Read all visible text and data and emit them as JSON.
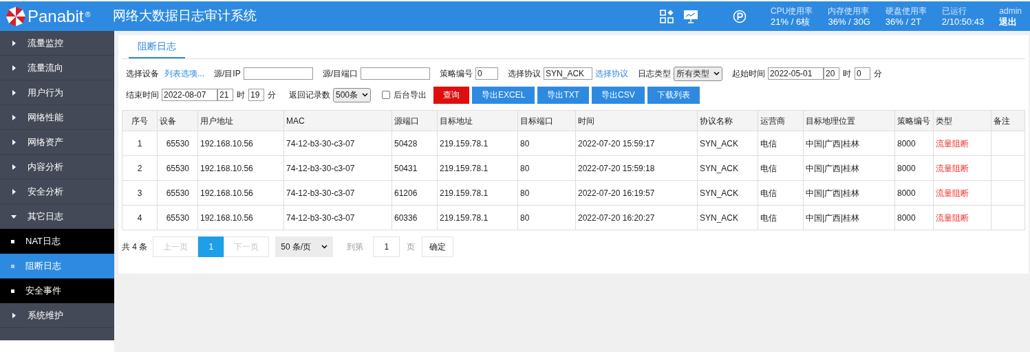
{
  "header": {
    "logo": "Panabit",
    "logo_mark": "®",
    "title": "网络大数据日志审计系统",
    "stats": [
      {
        "label": "CPU使用率",
        "value": "21% / 6核"
      },
      {
        "label": "内存使用率",
        "value": "36% / 30G"
      },
      {
        "label": "硬盘使用率",
        "value": "36% / 2T"
      },
      {
        "label": "已运行",
        "value": "2/10:50:43"
      }
    ],
    "user": "admin",
    "logout": "退出"
  },
  "sidebar": {
    "items": [
      {
        "label": "流量监控",
        "expanded": false
      },
      {
        "label": "流量流向",
        "expanded": false
      },
      {
        "label": "用户行为",
        "expanded": false
      },
      {
        "label": "网络性能",
        "expanded": false
      },
      {
        "label": "网络资产",
        "expanded": false
      },
      {
        "label": "内容分析",
        "expanded": false
      },
      {
        "label": "安全分析",
        "expanded": false
      },
      {
        "label": "其它日志",
        "expanded": true,
        "children": [
          {
            "label": "NAT日志",
            "selected": false
          },
          {
            "label": "阻断日志",
            "selected": true
          },
          {
            "label": "安全事件",
            "selected": false
          }
        ]
      },
      {
        "label": "系统维护",
        "expanded": false
      }
    ]
  },
  "tabs": [
    {
      "label": "阻断日志",
      "selected": true
    }
  ],
  "filters": [
    [
      {
        "kind": "label",
        "text": "选择设备"
      },
      {
        "kind": "link",
        "text": "列表选项..."
      },
      {
        "kind": "label",
        "text": "源/目IP"
      },
      {
        "kind": "input"
      },
      {
        "kind": "label",
        "text": "源/目端口"
      },
      {
        "kind": "input"
      },
      {
        "kind": "label",
        "text": "策略编号"
      },
      {
        "kind": "input",
        "value": "0"
      },
      {
        "kind": "label",
        "text": "选择协议"
      },
      {
        "kind": "input",
        "value": "SYN_ACK"
      },
      {
        "kind": "link",
        "text": "选择协议"
      },
      {
        "kind": "label",
        "text": "日志类型"
      },
      {
        "kind": "select",
        "value": "所有类型"
      },
      {
        "kind": "label",
        "text": "起始时间"
      },
      {
        "kind": "input",
        "value": "2022-05-01"
      },
      {
        "kind": "input",
        "value": "20"
      },
      {
        "kind": "unit",
        "text": "时"
      },
      {
        "kind": "input",
        "value": "0"
      },
      {
        "kind": "unit",
        "text": "分"
      }
    ],
    [
      {
        "kind": "label",
        "text": "结束时间"
      },
      {
        "kind": "input",
        "value": "2022-08-07"
      },
      {
        "kind": "input",
        "value": "21"
      },
      {
        "kind": "unit",
        "text": "时"
      },
      {
        "kind": "input",
        "value": "19"
      },
      {
        "kind": "unit",
        "text": "分"
      },
      {
        "kind": "label",
        "text": "返回记录数"
      },
      {
        "kind": "select",
        "value": "500条"
      },
      {
        "kind": "checkbox",
        "text": "后台导出",
        "checked": false
      },
      {
        "kind": "submit",
        "text": "查询"
      },
      {
        "kind": "button",
        "text": "导出EXCEL"
      },
      {
        "kind": "button",
        "text": "导出TXT"
      },
      {
        "kind": "button",
        "text": "导出CSV"
      },
      {
        "kind": "button",
        "text": "下载列表"
      }
    ]
  ],
  "table": {
    "columns": [
      "序号",
      "设备",
      "用户地址",
      "MAC",
      "源端口",
      "目标地址",
      "目标端口",
      "时间",
      "协议名称",
      "运营商",
      "目标地理位置",
      "策略编号",
      "类型",
      "备注"
    ],
    "rows": [
      [
        "1",
        "65530",
        "192.168.10.56",
        "74-12-b3-30-c3-07",
        "50428",
        "219.159.78.1",
        "80",
        "2022-07-20 15:59:17",
        "SYN_ACK",
        "电信",
        "中国|广西|桂林",
        "8000",
        "流量阻断",
        ""
      ],
      [
        "2",
        "65530",
        "192.168.10.56",
        "74-12-b3-30-c3-07",
        "50431",
        "219.159.78.1",
        "80",
        "2022-07-20 15:59:18",
        "SYN_ACK",
        "电信",
        "中国|广西|桂林",
        "8000",
        "流量阻断",
        ""
      ],
      [
        "3",
        "65530",
        "192.168.10.56",
        "74-12-b3-30-c3-07",
        "61206",
        "219.159.78.1",
        "80",
        "2022-07-20 16:19:57",
        "SYN_ACK",
        "电信",
        "中国|广西|桂林",
        "8000",
        "流量阻断",
        ""
      ],
      [
        "4",
        "65530",
        "192.168.10.56",
        "74-12-b3-30-c3-07",
        "60336",
        "219.159.78.1",
        "80",
        "2022-07-20 16:20:27",
        "SYN_ACK",
        "电信",
        "中国|广西|桂林",
        "8000",
        "流量阻断",
        ""
      ]
    ]
  },
  "pagination": {
    "total": "共 4 条",
    "prev": "上一页",
    "pages": [
      {
        "label": "1",
        "selected": true
      }
    ],
    "next": "下一页",
    "page_size": "50 条/页",
    "goto_label": "到第",
    "goto_value": "1",
    "page_unit": "页",
    "confirm": "确定"
  }
}
